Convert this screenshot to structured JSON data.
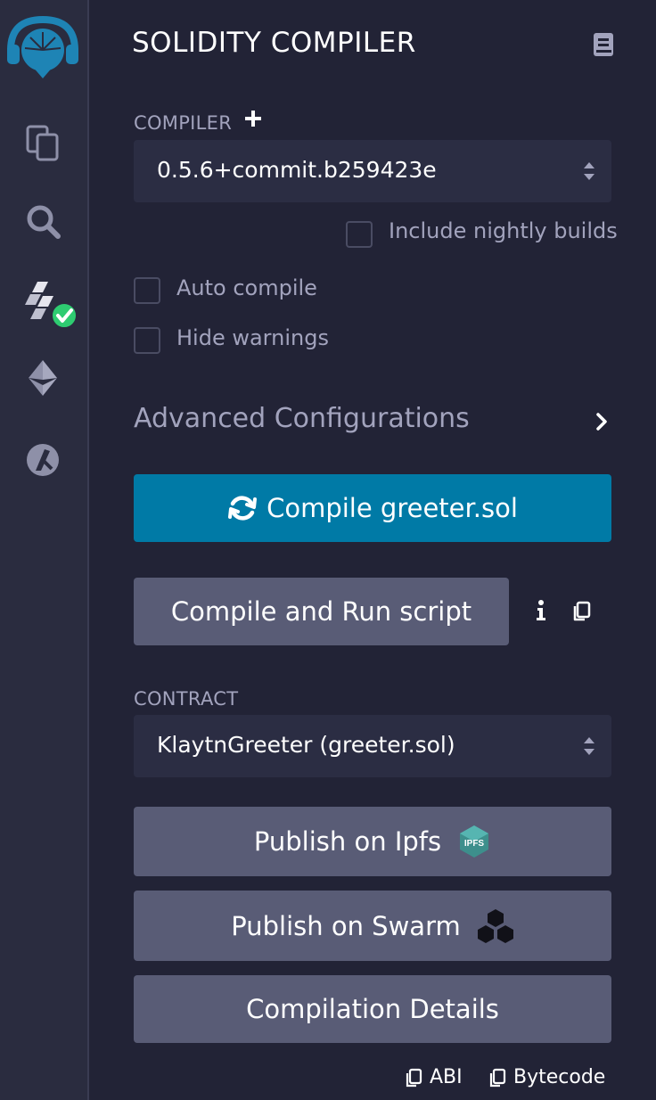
{
  "panel": {
    "title": "SOLIDITY COMPILER"
  },
  "compiler": {
    "label": "COMPILER",
    "selected_version": "0.5.6+commit.b259423e",
    "include_nightly_label": "Include nightly builds"
  },
  "options": {
    "auto_compile_label": "Auto compile",
    "hide_warnings_label": "Hide warnings"
  },
  "advanced": {
    "label": "Advanced Configurations"
  },
  "buttons": {
    "compile_label": "Compile greeter.sol",
    "compile_run_label": "Compile and Run script",
    "publish_ipfs_label": "Publish on Ipfs",
    "publish_swarm_label": "Publish on Swarm",
    "compilation_details_label": "Compilation Details"
  },
  "contract": {
    "label": "CONTRACT",
    "selected": "KlaytnGreeter (greeter.sol)"
  },
  "footer": {
    "abi_label": "ABI",
    "bytecode_label": "Bytecode"
  },
  "icons": {
    "ipfs_badge_text": "IPFS"
  },
  "colors": {
    "primary_button": "#007aa6",
    "secondary_button": "#595c76",
    "brand_blue": "#1e84b5",
    "success_green": "#2ecc71"
  }
}
